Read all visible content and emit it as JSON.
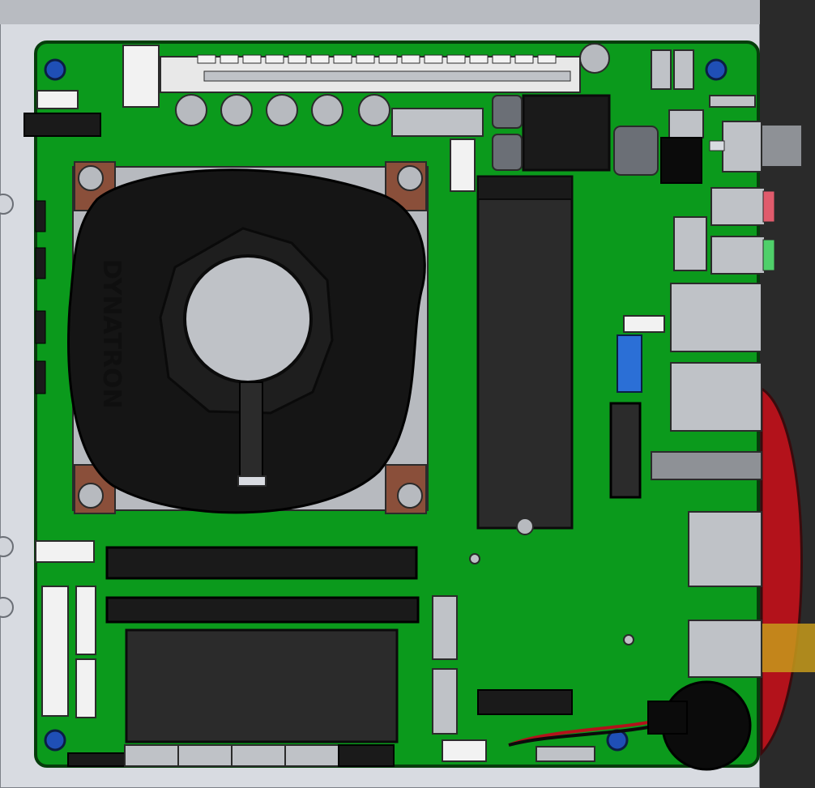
{
  "scene": {
    "kind": "cad-render",
    "subject": "mini-itx-motherboard-with-blower-cooler"
  },
  "cooler": {
    "brand_text": "DYNATRON"
  },
  "colors": {
    "background": "#c9ccd3",
    "chassis": "#d8dbe1",
    "pcb": "#0b9a1c",
    "pcb_edge": "#063d0c",
    "component_dark": "#1a1a1a",
    "component_mid": "#2b2b2b",
    "metal_light": "#b7babf",
    "metal_mid": "#8e9196",
    "copper": "#8a4f3a",
    "connector_white": "#f2f2f2",
    "hole_blue": "#1f4fb6",
    "header_blue": "#2b6fd6",
    "red_disk": "#b3121b",
    "audio_pink": "#e05b6c",
    "audio_green": "#4fd06a",
    "rtc_black": "#0b0b0b",
    "gold": "#c69a1b"
  }
}
